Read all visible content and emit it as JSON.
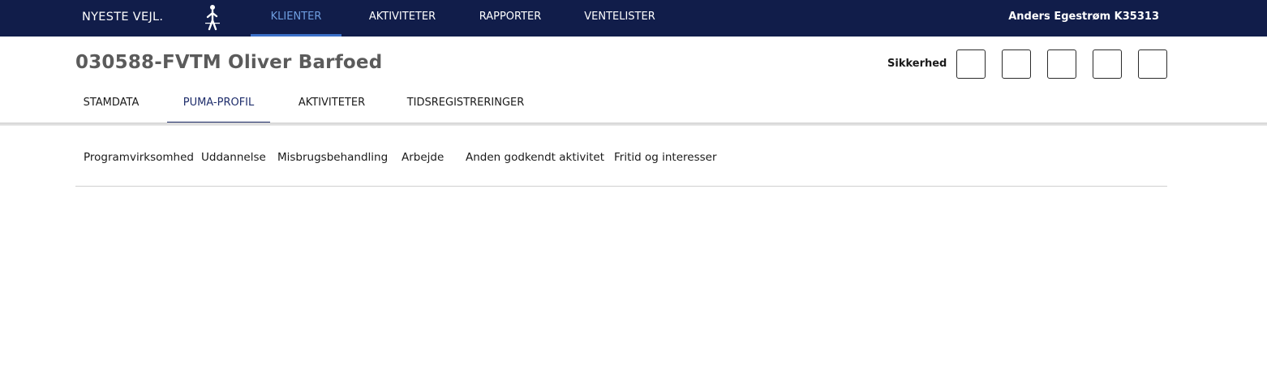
{
  "topnav": {
    "brand_label": "NYESTE VEJL.",
    "logo_icon": "walking-figure-icon",
    "items": [
      {
        "label": "KLIENTER",
        "active": true
      },
      {
        "label": "AKTIVITETER",
        "active": false
      },
      {
        "label": "RAPPORTER",
        "active": false
      },
      {
        "label": "VENTELISTER",
        "active": false
      }
    ],
    "user": "Anders Egestrøm K35313",
    "colors": {
      "background": "#111d4a",
      "active": "#6f9ee0"
    }
  },
  "client": {
    "title": "030588-FVTM Oliver Barfoed",
    "security_label": "Sikkerhed",
    "security_boxes": [
      "",
      "",
      "",
      "",
      ""
    ]
  },
  "tabs": [
    {
      "label": "STAMDATA",
      "active": false
    },
    {
      "label": "PUMA-PROFIL",
      "active": true
    },
    {
      "label": "AKTIVITETER",
      "active": false
    },
    {
      "label": "TIDSREGISTRERINGER",
      "active": false
    }
  ],
  "subtabs": [
    {
      "label": "Programvirksomhed"
    },
    {
      "label": "Uddannelse"
    },
    {
      "label": "Misbrugsbehandling"
    },
    {
      "label": "Arbejde"
    },
    {
      "label": "Anden godkendt aktivitet"
    },
    {
      "label": "Fritid og interesser"
    }
  ]
}
